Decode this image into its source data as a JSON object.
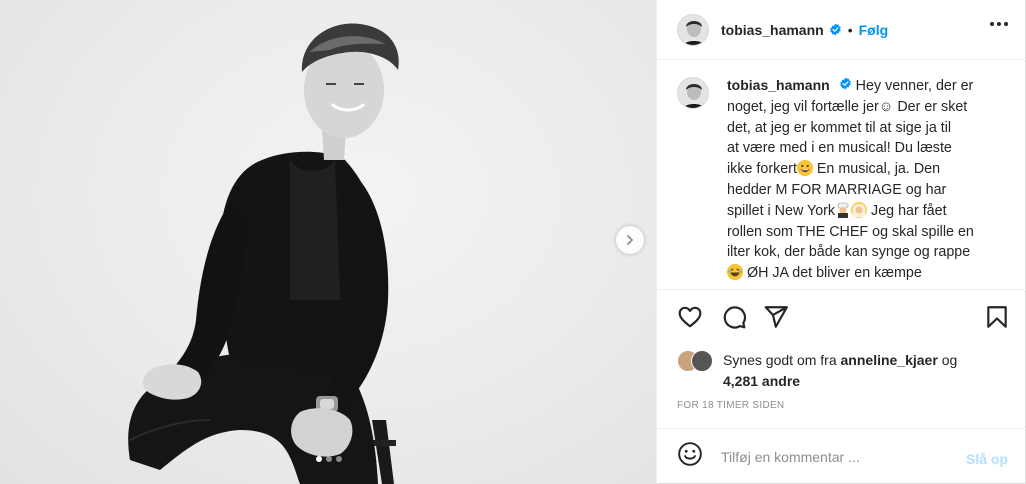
{
  "post": {
    "username": "tobias_hamann",
    "follow_label": "Følg",
    "separator": "•",
    "caption_lines": [
      "Hey venner, der er",
      "noget, jeg vil fortælle jer☺ Der er sket",
      "det, at jeg er kommet til at sige ja til",
      "at være med i en musical! Du læste",
      "ikke forkert",
      " En musical, ja. Den",
      "hedder M FOR MARRIAGE og har",
      "spillet i New York",
      " Jeg har fået",
      "rollen som THE CHEF og skal spille en",
      "ilter kok, der både kan synge og rappe",
      " ØH JA det bliver en kæmpe"
    ],
    "likes_prefix": "Synes godt om fra",
    "likes_user": "anneline_kjaer",
    "likes_and": "og",
    "likes_count": "4,281 andre",
    "timestamp": "FOR 18 TIMER SIDEN",
    "comment_placeholder": "Tilføj en kommentar ...",
    "post_label": "Slå op",
    "carousel_total": 3,
    "carousel_active": 1
  },
  "icons": {
    "verified": "verified-badge-icon",
    "more": "more-options-icon",
    "like": "heart-icon",
    "comment": "comment-bubble-icon",
    "share": "paper-plane-icon",
    "save": "bookmark-icon",
    "emoji": "smiley-icon",
    "next": "chevron-right-icon"
  },
  "colors": {
    "accent": "#0095f6",
    "post_button_disabled": "#b2dffc",
    "text": "#262626",
    "muted": "#8e8e8e",
    "border": "#efefef"
  }
}
